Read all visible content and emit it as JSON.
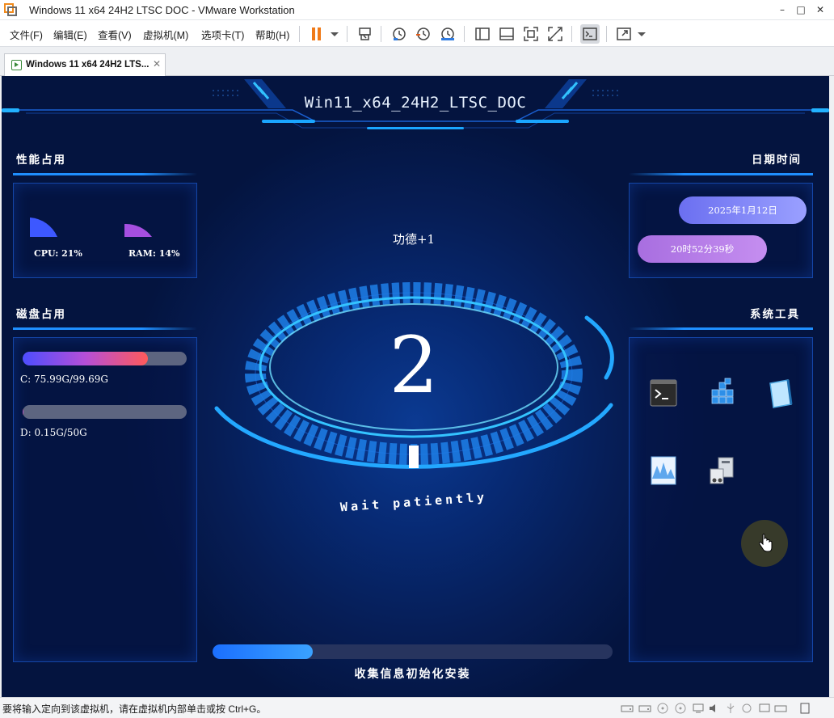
{
  "window": {
    "title": "Windows 11 x64 24H2 LTSC DOC - VMware Workstation",
    "controls": {
      "minimize": "–",
      "maximize": "□",
      "close": "✕"
    }
  },
  "menu": {
    "items": [
      "文件(F)",
      "编辑(E)",
      "查看(V)",
      "虚拟机(M)",
      "选项卡(T)",
      "帮助(H)"
    ]
  },
  "toolbar": {
    "icons": [
      "pause-icon",
      "dropdown-icon",
      "send-keys-icon",
      "snapshot-icon",
      "revert-snapshot-icon",
      "snapshot-manager-icon",
      "library-icon",
      "thumbnail-icon",
      "fullscreen-icon",
      "unity-icon",
      "console-icon",
      "stretch-icon"
    ]
  },
  "tab": {
    "label": "Windows 11 x64 24H2 LTS...",
    "close": "✕"
  },
  "vm": {
    "title": "Win11_x64_24H2_LTSC_DOC",
    "performance": {
      "title": "性能占用",
      "cpu_label": "CPU: 21%",
      "ram_label": "RAM: 14%",
      "cpu_percent": 21,
      "ram_percent": 14
    },
    "disk": {
      "title": "磁盘占用",
      "drives": [
        {
          "label": "C: 75.99G/99.69G",
          "used_fraction": 0.762
        },
        {
          "label": "D: 0.15G/50G",
          "used_fraction": 0.003
        }
      ]
    },
    "datetime": {
      "title": "日期时间",
      "date": "2025年1月12日",
      "time": "20时52分39秒"
    },
    "tools": {
      "title": "系统工具",
      "icons": [
        "terminal-icon",
        "registry-editor-icon",
        "notepad-icon",
        "resource-monitor-icon",
        "device-manager-icon"
      ]
    },
    "greeting": "功德+1",
    "countdown": "2",
    "wait_text": "Wait patiently",
    "progress": {
      "fraction": 0.25,
      "label": "收集信息初始化安装"
    }
  },
  "statusbar": {
    "text": "要将输入定向到该虚拟机，请在虚拟机内部单击或按 Ctrl+G。"
  },
  "colors": {
    "accent_blue": "#1f8fff",
    "date_pill": "#7c7ff0",
    "time_pill": "#b27ae0"
  }
}
